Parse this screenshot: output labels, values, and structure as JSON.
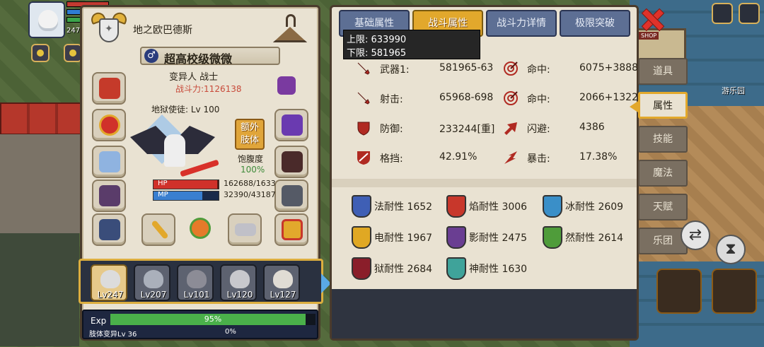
{
  "hud": {
    "level": "247",
    "hp_label": "HP",
    "top_value": "162688"
  },
  "character": {
    "guild_name": "地之欧巴德斯",
    "title": "超高校级微微",
    "race_class": "变异人 战士",
    "power_label": "战斗力:",
    "power_value": "1126138",
    "sub_class": "地狱使徒: Lv 100",
    "extra_limb_label": "额外肢体",
    "satiety_label": "饱腹度",
    "satiety_value": "100%",
    "hp_label": "HP",
    "hp_value": "162688/1633",
    "hp_fraction": 0.98,
    "mp_label": "MP",
    "mp_value": "32390/43187",
    "mp_fraction": 0.75
  },
  "party": [
    {
      "level": "Lv247",
      "active": true
    },
    {
      "level": "Lv207",
      "active": false
    },
    {
      "level": "Lv101",
      "active": false
    },
    {
      "level": "Lv120",
      "active": false
    },
    {
      "level": "Lv127",
      "active": false
    }
  ],
  "exp": {
    "label": "Exp",
    "percent_text": "95%",
    "fraction": 0.95,
    "limb_label": "肢体变异Lv 36",
    "limb_percent_text": "0%"
  },
  "tabs": [
    {
      "label": "基础属性",
      "active": false
    },
    {
      "label": "战斗属性",
      "active": true
    },
    {
      "label": "战斗力详情",
      "active": false
    },
    {
      "label": "极限突破",
      "active": false
    }
  ],
  "tooltip": {
    "upper": "上限: 633990",
    "lower": "下限: 581965"
  },
  "stats": [
    {
      "label": "武器1:",
      "value": "581965-63",
      "icon": "sword-icon"
    },
    {
      "label": "命中:",
      "value": "6075+3888",
      "icon": "target-icon"
    },
    {
      "label": "射击:",
      "value": "65968-698",
      "icon": "sword-icon"
    },
    {
      "label": "命中:",
      "value": "2066+1322",
      "icon": "target-icon"
    },
    {
      "label": "防御:",
      "value": "233244[重]",
      "icon": "shield-icon"
    },
    {
      "label": "闪避:",
      "value": "4386",
      "icon": "dodge-icon"
    },
    {
      "label": "格挡:",
      "value": "42.91%",
      "icon": "block-icon"
    },
    {
      "label": "暴击:",
      "value": "17.38%",
      "icon": "crit-icon"
    }
  ],
  "resistances": [
    {
      "text": "法耐性 1652",
      "color": "#3f5fb5"
    },
    {
      "text": "焰耐性 3006",
      "color": "#c8372b"
    },
    {
      "text": "冰耐性 2609",
      "color": "#3a8fc8"
    },
    {
      "text": "电耐性 1967",
      "color": "#e0a823"
    },
    {
      "text": "影耐性 2475",
      "color": "#6a3e92"
    },
    {
      "text": "然耐性 2614",
      "color": "#4f9c3a"
    },
    {
      "text": "狱耐性 2684",
      "color": "#8a1e2a"
    },
    {
      "text": "神耐性 1630",
      "color": "#3fa39a"
    }
  ],
  "side_menu": [
    {
      "label": "道具",
      "active": false
    },
    {
      "label": "属性",
      "active": true
    },
    {
      "label": "技能",
      "active": false
    },
    {
      "label": "魔法",
      "active": false
    },
    {
      "label": "天赋",
      "active": false
    },
    {
      "label": "乐团",
      "active": false
    }
  ],
  "world": {
    "shop_sign": "SHOP",
    "paradise_label": "游乐园"
  },
  "colors": {
    "panel_bg": "#e9e2d2",
    "tab_active": "#e2a82c",
    "tab_inactive": "#5d6f94",
    "power_red": "#c84a3a",
    "satiety_green": "#3f8b3a",
    "exp_green": "#4ab04a"
  }
}
